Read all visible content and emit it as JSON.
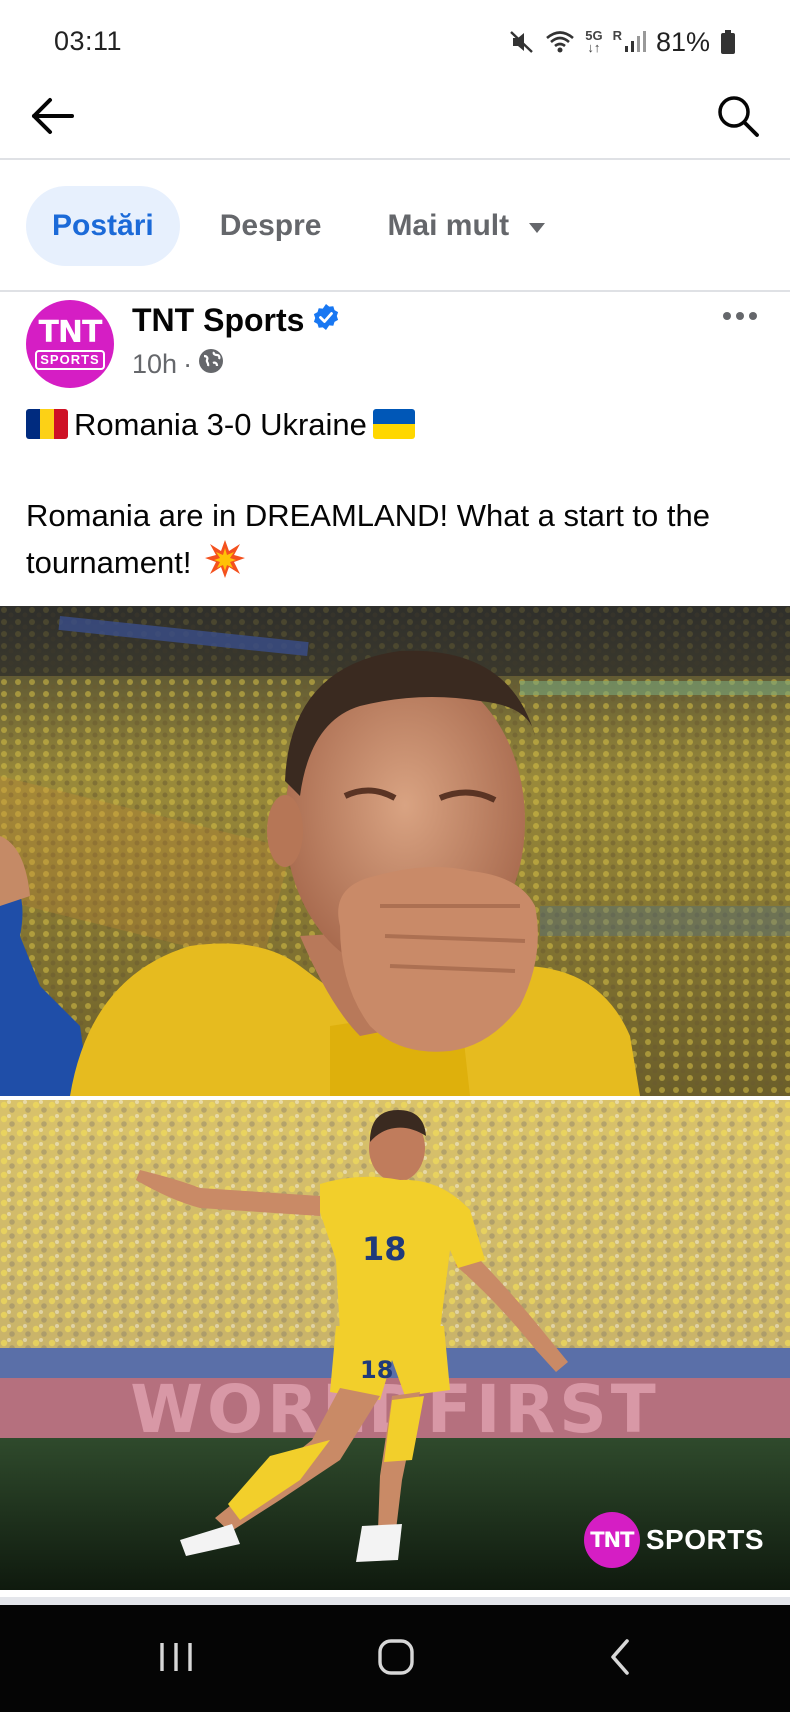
{
  "status_bar": {
    "time": "03:11",
    "network_top": "5G",
    "network_r": "R",
    "battery": "81%",
    "icons": [
      "mute-icon",
      "wifi-icon",
      "signal-icon",
      "battery-icon"
    ]
  },
  "app_bar": {
    "icons": [
      "back-arrow-icon",
      "search-icon"
    ]
  },
  "tabs": [
    {
      "label": "Postări",
      "active": true
    },
    {
      "label": "Despre",
      "active": false
    },
    {
      "label": "Mai mult",
      "active": false
    }
  ],
  "post": {
    "avatar": {
      "line1": "TNT",
      "line2": "SPORTS",
      "color": "#d51ec4"
    },
    "page_name": "TNT Sports",
    "verified": true,
    "time": "10h",
    "separator": "·",
    "audience_icon": "globe-icon",
    "headline": "Romania 3-0 Ukraine",
    "body": "Romania are in DREAMLAND! What a start to the tournament!",
    "emojis": [
      "romania-flag",
      "ukraine-flag",
      "collision-emoji"
    ],
    "images": [
      {
        "description_icon": "photo-player-emotional"
      },
      {
        "description_icon": "photo-player-celebrating"
      }
    ],
    "watermark": {
      "line1": "TNT",
      "line2": "SPORTS"
    },
    "banner_text": "WORLDFIRST"
  },
  "colors": {
    "active_tab_bg": "#e7f0fd",
    "active_tab_text": "#1b6ad8",
    "verified_blue": "#1877f2",
    "brand_magenta": "#d51ec4"
  }
}
